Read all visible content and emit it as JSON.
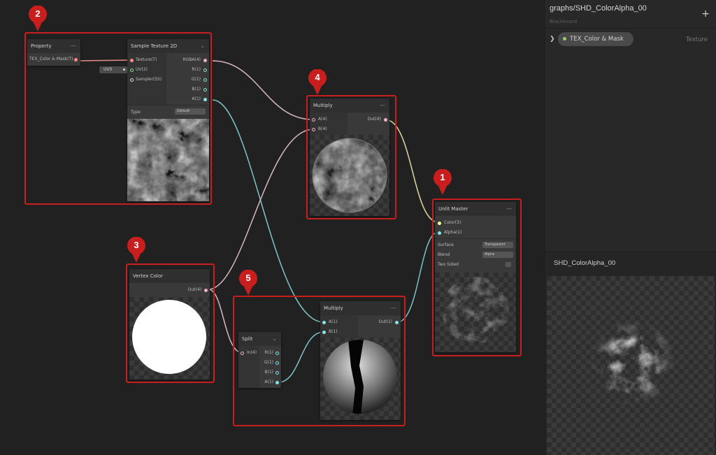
{
  "blackboard": {
    "title": "graphs/SHD_ColorAlpha_00",
    "subtitle": "Blackboard",
    "add_label": "+",
    "property": {
      "name": "TEX_Color & Mask",
      "type": "Texture",
      "dot_color": "#8fd06a"
    }
  },
  "preview": {
    "title": "SHD_ColorAlpha_00"
  },
  "annotations": [
    "2",
    "4",
    "1",
    "3",
    "5"
  ],
  "annotation_color": "#c81e1e",
  "nodes": {
    "property": {
      "title": "Property",
      "output": "TEX_Color & Mask(T)"
    },
    "sample": {
      "title": "Sample Texture 2D",
      "inputs": [
        "Texture(T)",
        "UV(2)",
        "Sampler(SS)"
      ],
      "outputs": [
        "RGBA(4)",
        "R(1)",
        "G(1)",
        "B(1)",
        "A(1)"
      ],
      "uv_chip": "UV0",
      "type_label": "Type",
      "type_value": "Default"
    },
    "multiply1": {
      "title": "Multiply",
      "inputs": [
        "A(4)",
        "B(4)"
      ],
      "output": "Out(4)"
    },
    "vertex": {
      "title": "Vertex Color",
      "output": "Out(4)"
    },
    "split": {
      "title": "Split",
      "input": "In(4)",
      "outputs": [
        "R(1)",
        "G(1)",
        "B(1)",
        "A(1)"
      ]
    },
    "multiply2": {
      "title": "Multiply",
      "inputs": [
        "A(1)",
        "B(1)"
      ],
      "output": "Out(1)"
    },
    "master": {
      "title": "Unlit Master",
      "inputs": [
        "Color(3)",
        "Alpha(1)"
      ],
      "settings": [
        {
          "label": "Surface",
          "value": "Transparent"
        },
        {
          "label": "Blend",
          "value": "Alpha"
        },
        {
          "label": "Two Sided",
          "value": ""
        }
      ]
    }
  },
  "colors": {
    "vector4": "#f0b0c8",
    "vector1": "#84e4e7",
    "vector3": "#f6ff9a",
    "texture": "#ff8b8b",
    "uv": "#8fe08f"
  }
}
